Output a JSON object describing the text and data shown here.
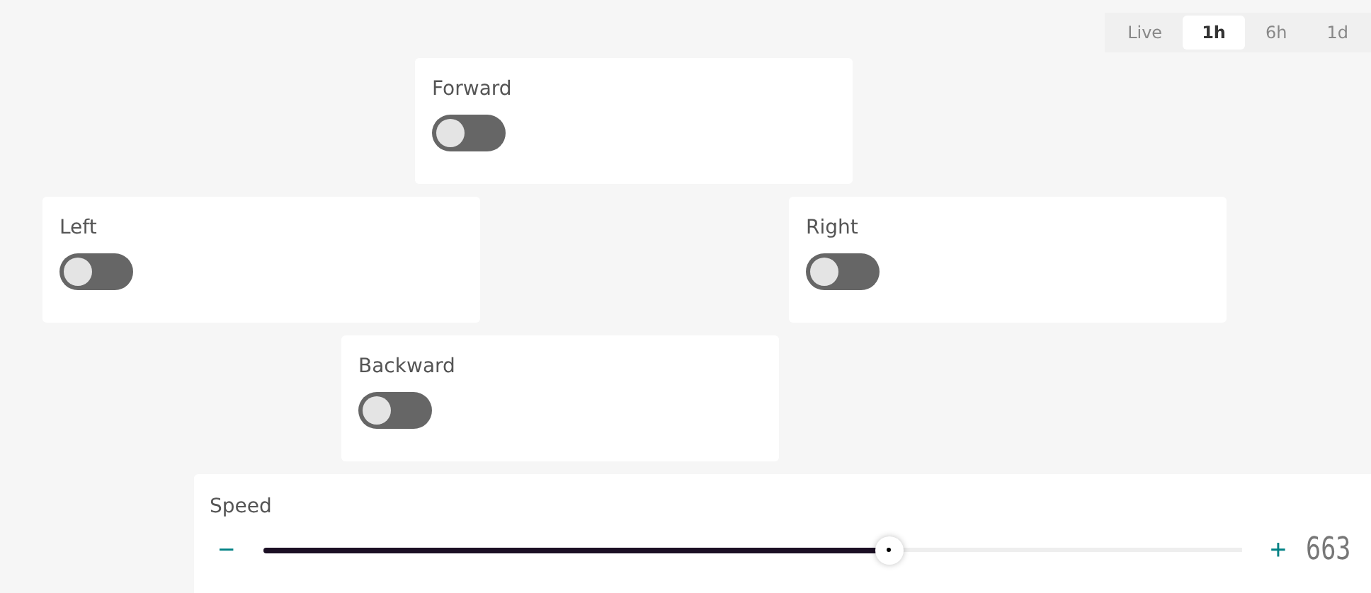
{
  "time_range": [
    {
      "label": "Live",
      "selected": false
    },
    {
      "label": "1h",
      "selected": true
    },
    {
      "label": "6h",
      "selected": false
    },
    {
      "label": "1d",
      "selected": false
    }
  ],
  "switches": [
    {
      "label": "Forward",
      "on": false
    },
    {
      "label": "Left",
      "on": false
    },
    {
      "label": "Right",
      "on": false
    },
    {
      "label": "Backward",
      "on": false
    }
  ],
  "slider": {
    "label": "Speed",
    "decrement": "−",
    "increment": "+",
    "level": 0.64,
    "reading": "663"
  }
}
